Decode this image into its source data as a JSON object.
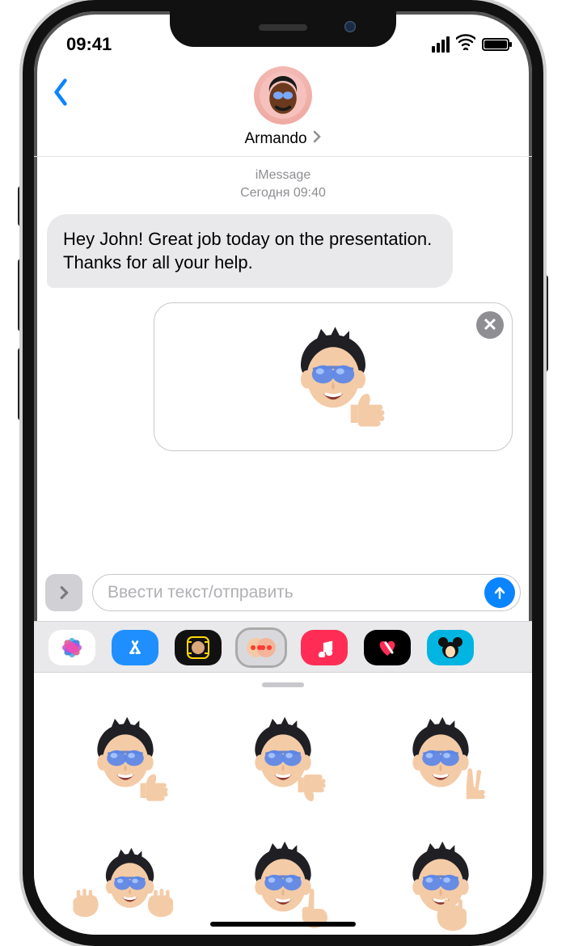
{
  "status": {
    "time": "09:41"
  },
  "contact": {
    "name": "Armando"
  },
  "thread": {
    "service": "iMessage",
    "timestamp": "Сегодня 09:40",
    "incoming_text": "Hey John! Great job today on the presentation. Thanks for all your help."
  },
  "compose": {
    "placeholder": "Ввести текст/отправить",
    "staged_sticker": "memoji-thumbs-up"
  },
  "app_strip": {
    "items": [
      {
        "name": "photos-app-icon"
      },
      {
        "name": "app-store-icon"
      },
      {
        "name": "animoji-app-icon"
      },
      {
        "name": "memoji-stickers-app-icon",
        "selected": true
      },
      {
        "name": "apple-music-app-icon"
      },
      {
        "name": "digital-touch-app-icon"
      },
      {
        "name": "sticker-pack-app-icon"
      }
    ]
  },
  "sticker_drawer": {
    "stickers": [
      "memoji-thumbs-up",
      "memoji-thumbs-down",
      "memoji-peace-sign",
      "memoji-jazz-hands",
      "memoji-point-up",
      "memoji-shush"
    ]
  },
  "icon_glyphs": {
    "close": "✕"
  }
}
